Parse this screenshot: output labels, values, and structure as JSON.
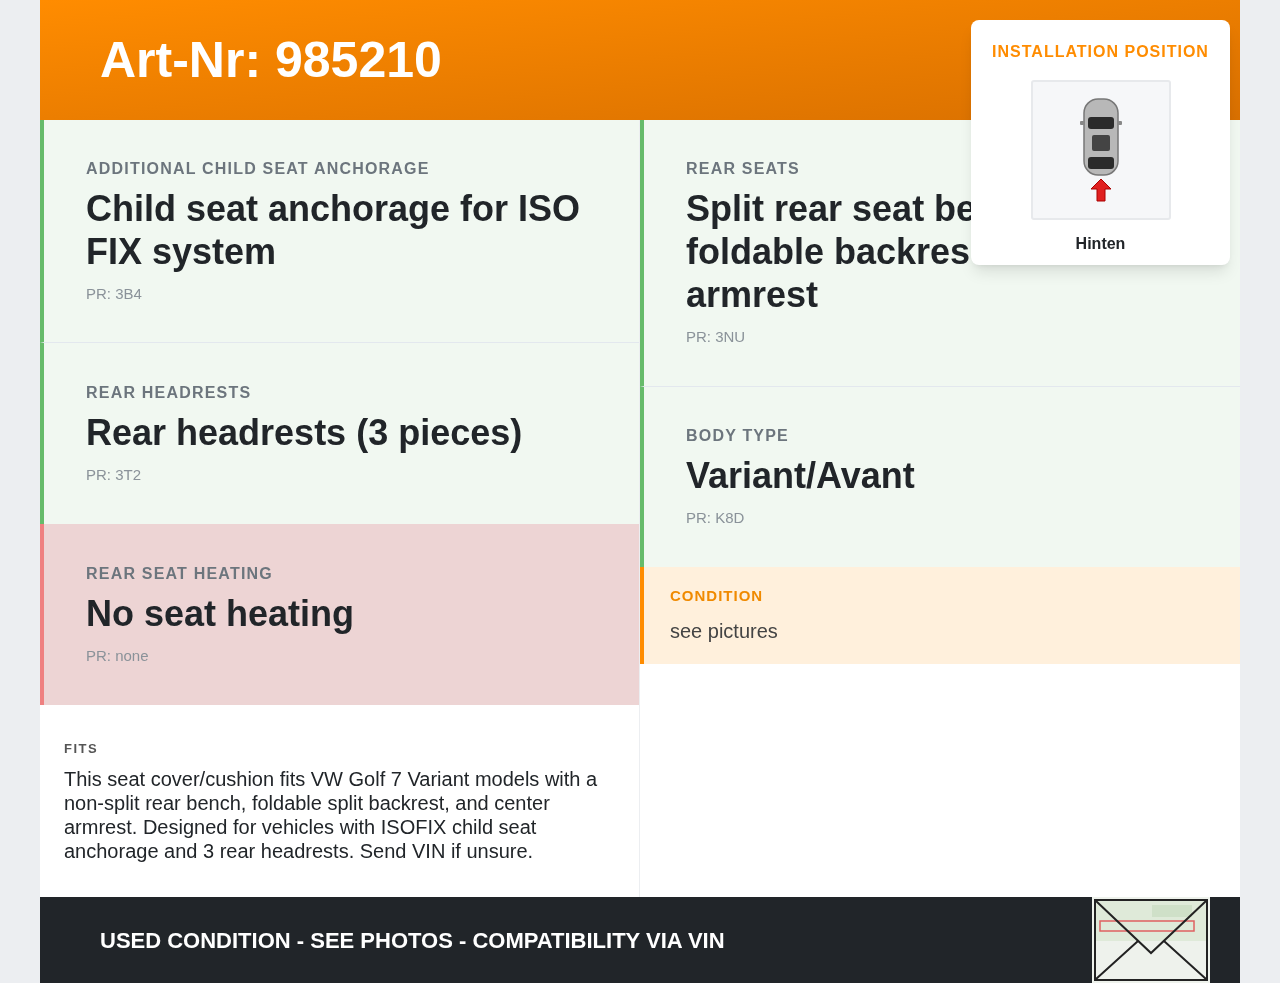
{
  "header": {
    "title": "Art-Nr: 985210"
  },
  "left_cards": [
    {
      "missing": false,
      "label": "ADDITIONAL CHILD SEAT ANCHORAGE",
      "title_lines": [
        "Child seat anchorage for ISO",
        "FIX system"
      ],
      "pr": "PR: 3B4"
    },
    {
      "missing": false,
      "label": "REAR HEADRESTS",
      "title_lines": [
        "Rear headrests (3 pieces)"
      ],
      "pr": "PR: 3T2"
    },
    {
      "missing": true,
      "label": "REAR SEAT HEATING",
      "title_lines": [
        "No seat heating"
      ],
      "pr": "PR: none"
    }
  ],
  "right_cards": [
    {
      "missing": false,
      "label": "REAR SEATS",
      "title_lines": [
        "Split rear seat be",
        "foldable backres",
        "armrest"
      ],
      "pr": "PR: 3NU"
    },
    {
      "missing": false,
      "label": "BODY TYPE",
      "title_lines": [
        "Variant/Avant"
      ],
      "pr": "PR: K8D"
    }
  ],
  "condition": {
    "label": "CONDITION",
    "text": "see pictures"
  },
  "fits": {
    "label": "FITS",
    "text": "This seat cover/cushion fits VW Golf 7 Variant models with a non-split rear bench, foldable split backrest, and center armrest. Designed for vehicles with ISOFIX child seat anchorage and 3 rear headrests. Send VIN if unsure."
  },
  "installation_position": {
    "label": "INSTALLATION POSITION",
    "position": "Hinten"
  },
  "footer": {
    "text": "USED CONDITION - SEE PHOTOS - COMPATIBILITY VIA VIN"
  }
}
